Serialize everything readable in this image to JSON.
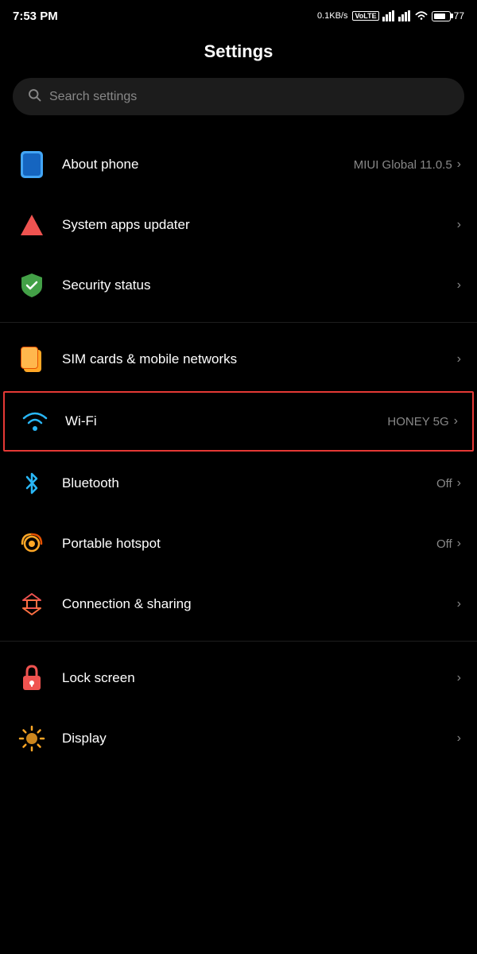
{
  "statusBar": {
    "time": "7:53 PM",
    "speed": "0.1KB/s",
    "battery": "77"
  },
  "page": {
    "title": "Settings"
  },
  "search": {
    "placeholder": "Search settings"
  },
  "settingsGroups": [
    {
      "id": "system",
      "items": [
        {
          "id": "about-phone",
          "label": "About phone",
          "value": "MIUI Global 11.0.5",
          "iconType": "phone",
          "chevron": ">"
        },
        {
          "id": "system-apps-updater",
          "label": "System apps updater",
          "value": "",
          "iconType": "arrow-up",
          "chevron": ">"
        },
        {
          "id": "security-status",
          "label": "Security status",
          "value": "",
          "iconType": "shield",
          "chevron": ">"
        }
      ]
    },
    {
      "id": "connectivity",
      "items": [
        {
          "id": "sim-cards",
          "label": "SIM cards & mobile networks",
          "value": "",
          "iconType": "sim",
          "chevron": ">"
        },
        {
          "id": "wifi",
          "label": "Wi-Fi",
          "value": "HONEY 5G",
          "iconType": "wifi",
          "chevron": ">",
          "highlighted": true
        },
        {
          "id": "bluetooth",
          "label": "Bluetooth",
          "value": "Off",
          "iconType": "bluetooth",
          "chevron": ">"
        },
        {
          "id": "portable-hotspot",
          "label": "Portable hotspot",
          "value": "Off",
          "iconType": "hotspot",
          "chevron": ">"
        },
        {
          "id": "connection-sharing",
          "label": "Connection & sharing",
          "value": "",
          "iconType": "connection",
          "chevron": ">"
        }
      ]
    },
    {
      "id": "personalization",
      "items": [
        {
          "id": "lock-screen",
          "label": "Lock screen",
          "value": "",
          "iconType": "lock",
          "chevron": ">"
        },
        {
          "id": "display",
          "label": "Display",
          "value": "",
          "iconType": "display",
          "chevron": ">"
        }
      ]
    }
  ]
}
